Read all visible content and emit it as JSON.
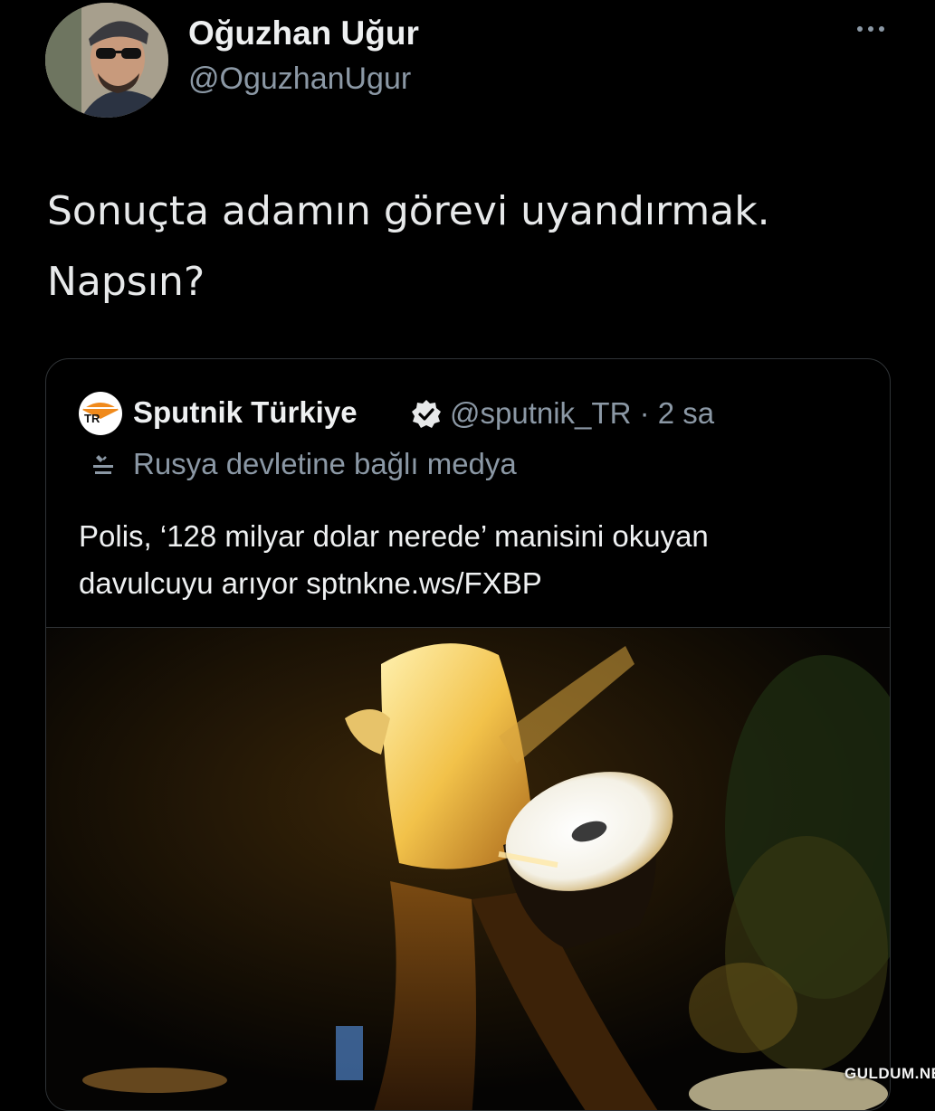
{
  "author": {
    "name": "Oğuzhan Uğur",
    "handle": "@OguzhanUgur",
    "avatar_icon": "user-avatar"
  },
  "menu": {
    "icon": "more-options-icon"
  },
  "tweet": {
    "lines": [
      "Sonuçta adamın görevi uyandırmak.",
      "Napsın?"
    ]
  },
  "quote": {
    "logo_text": "TR",
    "name": "Sputnik Türkiye",
    "verified_icon": "verified-badge-icon",
    "handle_time": "@sputnik_TR · 2 sa",
    "label_icon": "state-media-icon",
    "label": "Rusya devletine bağlı medya",
    "text_lines": [
      "Polis, ‘128 milyar dolar nerede’ manisini okuyan",
      "davulcuyu arıyor sptnkne.ws/FXBP"
    ]
  },
  "watermark": "GULDUM.NET",
  "colors": {
    "background": "#000000",
    "secondary_text": "#8b98a5",
    "verified": "#e7e9ea",
    "border": "#2f3336"
  }
}
